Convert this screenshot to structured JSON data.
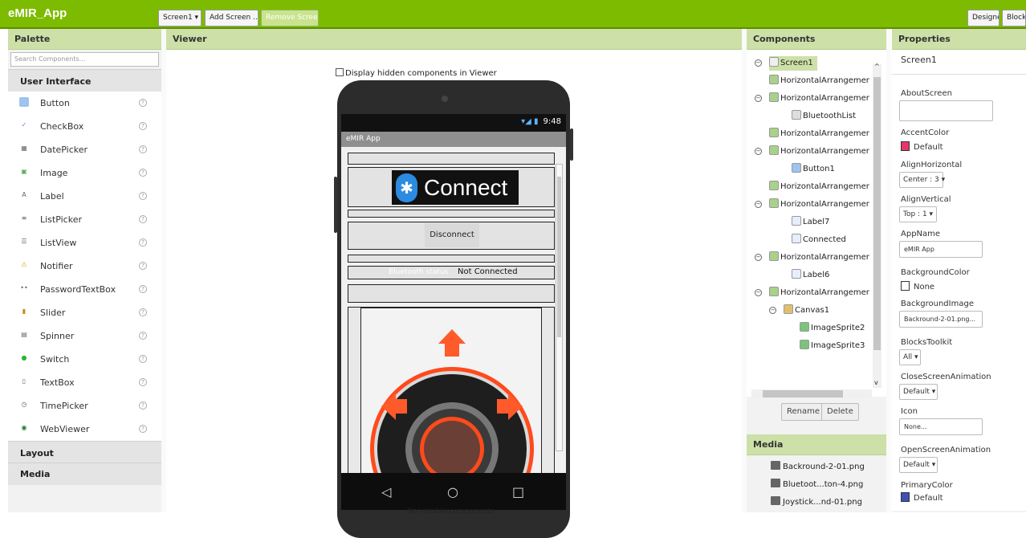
{
  "app_title": "eMIR_App",
  "toolbar": {
    "screen_select": "Screen1 ▾",
    "add_screen": "Add Screen ...",
    "remove_screen": "Remove Screen",
    "designer": "Designer",
    "blocks": "Blocks"
  },
  "palette": {
    "title": "Palette",
    "search_placeholder": "Search Components...",
    "category_ui": "User Interface",
    "items": [
      {
        "label": "Button",
        "icon": "button-icon"
      },
      {
        "label": "CheckBox",
        "icon": "checkbox-icon"
      },
      {
        "label": "DatePicker",
        "icon": "datepicker-icon"
      },
      {
        "label": "Image",
        "icon": "image-icon"
      },
      {
        "label": "Label",
        "icon": "label-icon"
      },
      {
        "label": "ListPicker",
        "icon": "listpicker-icon"
      },
      {
        "label": "ListView",
        "icon": "listview-icon"
      },
      {
        "label": "Notifier",
        "icon": "notifier-icon"
      },
      {
        "label": "PasswordTextBox",
        "icon": "password-icon"
      },
      {
        "label": "Slider",
        "icon": "slider-icon"
      },
      {
        "label": "Spinner",
        "icon": "spinner-icon"
      },
      {
        "label": "Switch",
        "icon": "switch-icon"
      },
      {
        "label": "TextBox",
        "icon": "textbox-icon"
      },
      {
        "label": "TimePicker",
        "icon": "timepicker-icon"
      },
      {
        "label": "WebViewer",
        "icon": "webviewer-icon"
      }
    ],
    "help_glyph": "?",
    "category_layout": "Layout",
    "category_media": "Media"
  },
  "viewer": {
    "title": "Viewer",
    "display_hidden": "Display hidden components in Viewer",
    "status_time": "9:48",
    "status_icons": "▾◢ ▮",
    "app_bar_title": "eMIR App",
    "connect_label": "Connect",
    "bt_glyph": "✱",
    "disconnect_label": "Disconnect",
    "bt_status_label": "Bluetooth status",
    "bt_status_value": "Not Connected",
    "nav_back": "◁",
    "nav_home": "○",
    "nav_recent": "□",
    "nonvisible": "Non-visible components"
  },
  "components": {
    "title": "Components",
    "tree": [
      "Screen1",
      "HorizontalArrangemer",
      "HorizontalArrangemer",
      "BluetoothList",
      "HorizontalArrangemer",
      "HorizontalArrangemer",
      "Button1",
      "HorizontalArrangemer",
      "HorizontalArrangemer",
      "Label7",
      "Connected",
      "HorizontalArrangemer",
      "Label6",
      "HorizontalArrangemer",
      "Canvas1",
      "ImageSprite2",
      "ImageSprite3"
    ],
    "rename": "Rename",
    "delete": "Delete",
    "media_title": "Media",
    "media_items": [
      "Backround-2-01.png",
      "Bluetoot...ton-4.png",
      "Joystick...nd-01.png"
    ]
  },
  "properties": {
    "title": "Properties",
    "screen": "Screen1",
    "about_screen_label": "AboutScreen",
    "accent_color_label": "AccentColor",
    "accent_color_value": "Default",
    "accent_color": "#e8336b",
    "align_h_label": "AlignHorizontal",
    "align_h_value": "Center : 3 ▾",
    "align_v_label": "AlignVertical",
    "align_v_value": "Top : 1 ▾",
    "app_name_label": "AppName",
    "app_name_value": "eMIR App",
    "bg_color_label": "BackgroundColor",
    "bg_color_value": "None",
    "bg_image_label": "BackgroundImage",
    "bg_image_value": "Backround-2-01.png...",
    "blocks_toolkit_label": "BlocksToolkit",
    "blocks_toolkit_value": "All ▾",
    "close_anim_label": "CloseScreenAnimation",
    "close_anim_value": "Default ▾",
    "icon_label": "Icon",
    "icon_value": "None...",
    "open_anim_label": "OpenScreenAnimation",
    "open_anim_value": "Default ▾",
    "primary_color_label": "PrimaryColor",
    "primary_color_value": "Default",
    "primary_color": "#3f51b5"
  }
}
